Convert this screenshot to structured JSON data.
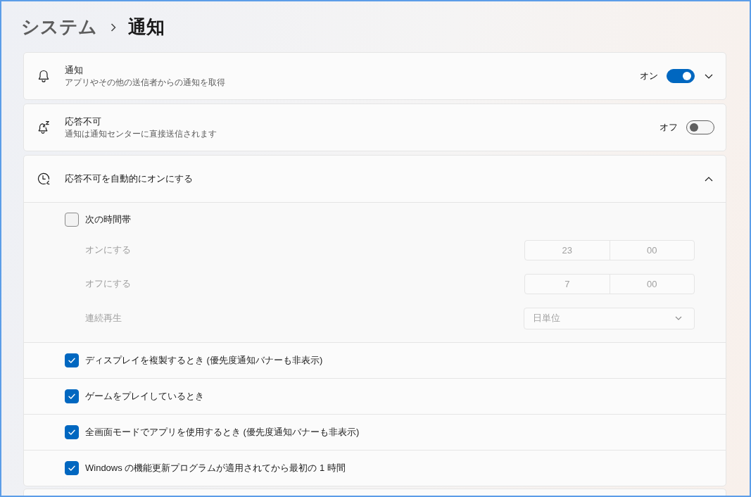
{
  "breadcrumb": [
    {
      "label": "システム",
      "current": false
    },
    {
      "label": "通知",
      "current": true
    }
  ],
  "notifications": {
    "title": "通知",
    "subtitle": "アプリやその他の送信者からの通知を取得",
    "toggle_label": "オン",
    "on": true,
    "expanded": false
  },
  "do_not_disturb": {
    "title": "応答不可",
    "subtitle": "通知は通知センターに直接送信されます",
    "toggle_label": "オフ",
    "on": false
  },
  "auto_do_not_disturb": {
    "title": "応答不可を自動的にオンにする",
    "expanded": true,
    "schedule": {
      "label": "次の時間帯",
      "checked": false,
      "rows": [
        {
          "kind": "time",
          "label": "オンにする",
          "hour": "23",
          "minute": "00",
          "disabled": true
        },
        {
          "kind": "time",
          "label": "オフにする",
          "hour": "7",
          "minute": "00",
          "disabled": true
        },
        {
          "kind": "dropdown",
          "label": "連続再生",
          "value": "日単位",
          "disabled": true
        }
      ]
    },
    "conditions": [
      {
        "label": "ディスプレイを複製するとき (優先度通知バナーも非表示)",
        "checked": true
      },
      {
        "label": "ゲームをプレイしているとき",
        "checked": true
      },
      {
        "label": "全画面モードでアプリを使用するとき (優先度通知バナーも非表示)",
        "checked": true
      },
      {
        "label": "Windows の機能更新プログラムが適用されてから最初の 1 時間",
        "checked": true
      }
    ]
  }
}
